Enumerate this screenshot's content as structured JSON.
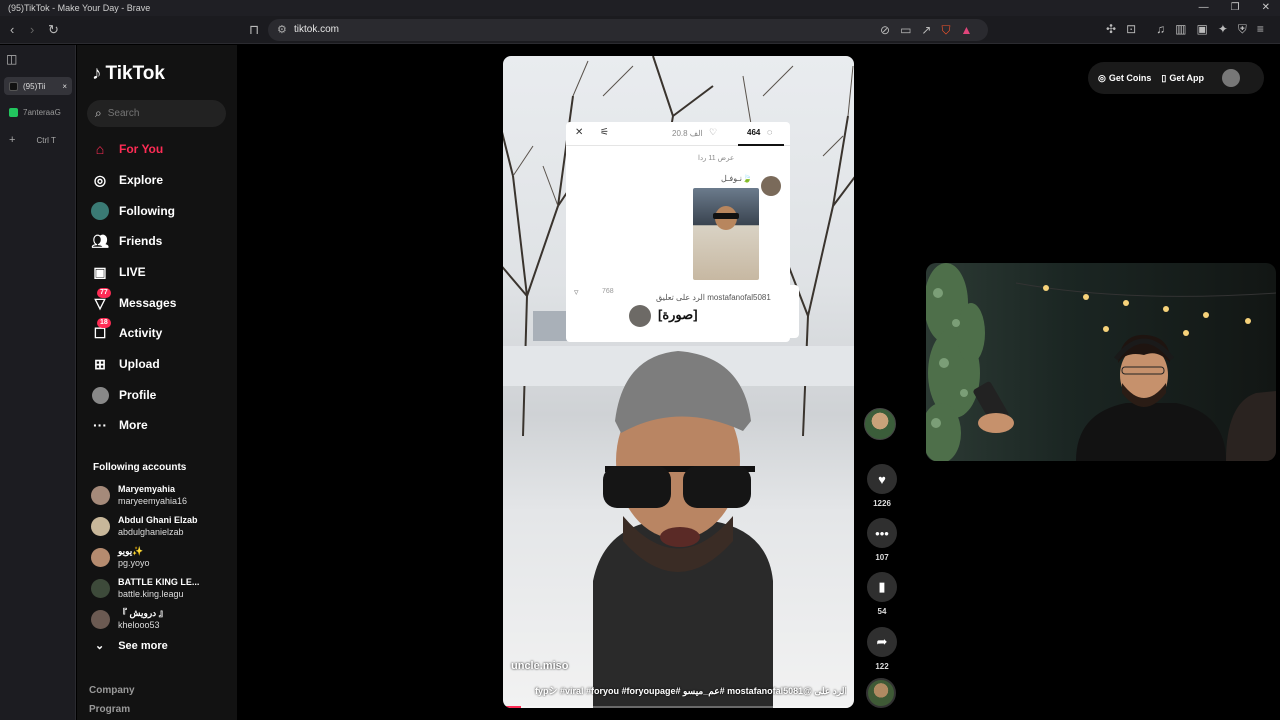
{
  "window": {
    "title": "(95)TikTok - Make Your Day - Brave",
    "controls": [
      "—",
      "❐",
      "✕"
    ]
  },
  "toolbar": {
    "url": "tiktok.com"
  },
  "vtabs": {
    "items": [
      {
        "label": "(95)Tii",
        "close": "×",
        "color": "#111111"
      },
      {
        "label": "7anteraaG",
        "close": "",
        "color": "#22c55e"
      }
    ],
    "new_tab": "+",
    "shortcut": "Ctrl   T"
  },
  "tiktok": {
    "logo": "TikTok",
    "search_placeholder": "Search",
    "nav": [
      {
        "label": "For You",
        "icon": "home-icon",
        "active": true
      },
      {
        "label": "Explore",
        "icon": "compass-icon"
      },
      {
        "label": "Following",
        "icon": "following-icon"
      },
      {
        "label": "Friends",
        "icon": "friends-icon"
      },
      {
        "label": "LIVE",
        "icon": "live-icon"
      },
      {
        "label": "Messages",
        "icon": "messages-icon",
        "badge": "77"
      },
      {
        "label": "Activity",
        "icon": "activity-icon",
        "badge": "18"
      },
      {
        "label": "Upload",
        "icon": "upload-icon"
      },
      {
        "label": "Profile",
        "icon": "profile-icon"
      },
      {
        "label": "More",
        "icon": "more-icon"
      }
    ],
    "following_title": "Following accounts",
    "following": [
      {
        "name": "Maryemyahia",
        "handle": "maryeemyahia16"
      },
      {
        "name": "Abdul Ghani Elzab",
        "handle": "abdulghanielzab"
      },
      {
        "name": "يويو✨",
        "handle": "pg.yoyo"
      },
      {
        "name": "BATTLE KING LE...",
        "handle": "battle.king.leagu"
      },
      {
        "name": "『 درويش 』",
        "handle": "khelooo53"
      }
    ],
    "see_more": "See more",
    "footer": [
      "Company",
      "Program"
    ]
  },
  "video": {
    "username": "uncle.miso",
    "caption": "الرد على @mostafanofal5081 #عم_ميسو #fypシ #viral #foryou #foryoupage",
    "progress": 0.05,
    "comment_overlay": {
      "comments_count": "464",
      "likes_count": "20.8 الف",
      "view_replies": "عرض 11 ردا",
      "commenter": "نـوفـل🍃",
      "comment_likes": "768",
      "reply_header": "الرد على تعليق mostafanofal5081",
      "reply_text": "[صورة]"
    }
  },
  "actions": {
    "likes": "1226",
    "comments": "107",
    "saves": "54",
    "shares": "122"
  },
  "top_right": {
    "coins": "Get Coins",
    "app": "Get App"
  }
}
